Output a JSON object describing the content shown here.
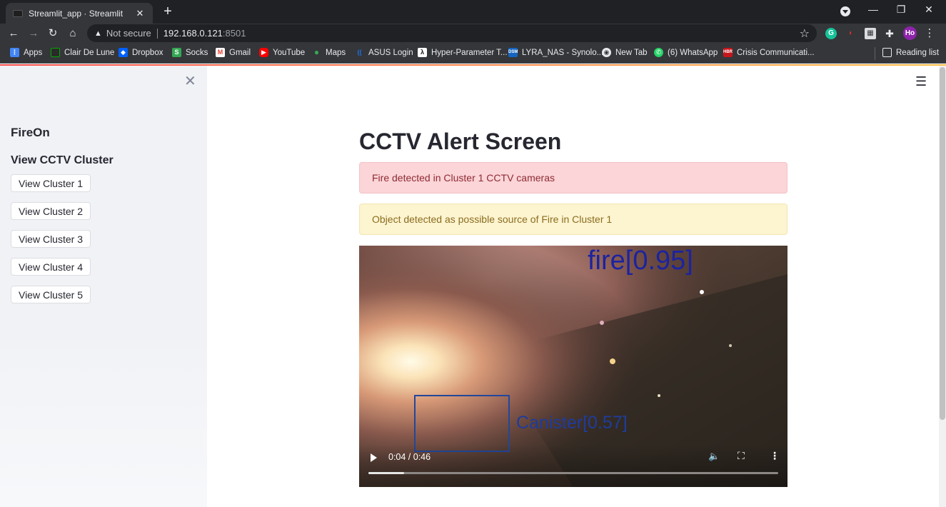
{
  "browser": {
    "tab_title": "Streamlit_app · Streamlit",
    "url_warning": "Not secure",
    "url_host": "192.168.0.121",
    "url_port": ":8501",
    "profile_initials": "Ho"
  },
  "bookmarks": [
    {
      "label": "Apps",
      "icon": "apps-grid-icon",
      "color": "#4285f4"
    },
    {
      "label": "Clair De Lune",
      "icon": "clair-icon",
      "color": "#2a2a2a"
    },
    {
      "label": "Dropbox",
      "icon": "dropbox-icon",
      "color": "#0061fe"
    },
    {
      "label": "Socks",
      "icon": "socks-icon",
      "color": "#34a853"
    },
    {
      "label": "Gmail",
      "icon": "gmail-icon",
      "color": "#ea4335"
    },
    {
      "label": "YouTube",
      "icon": "youtube-icon",
      "color": "#ff0000"
    },
    {
      "label": "Maps",
      "icon": "maps-icon",
      "color": "#34a853"
    },
    {
      "label": "ASUS Login",
      "icon": "asus-icon",
      "color": "#1a73e8"
    },
    {
      "label": "Hyper-Parameter T...",
      "icon": "lambda-icon",
      "color": "#111111"
    },
    {
      "label": "LYRA_NAS - Synolo...",
      "icon": "synology-icon",
      "color": "#1565c0"
    },
    {
      "label": "New Tab",
      "icon": "chrome-icon",
      "color": "#5f6368"
    },
    {
      "label": "(6) WhatsApp",
      "icon": "whatsapp-icon",
      "color": "#25d366"
    },
    {
      "label": "Crisis Communicati...",
      "icon": "hbr-icon",
      "color": "#c4161c"
    }
  ],
  "reading_list": "Reading list",
  "sidebar": {
    "title": "FireOn",
    "subheader": "View CCTV Cluster",
    "buttons": [
      "View Cluster 1",
      "View Cluster 2",
      "View Cluster 3",
      "View Cluster 4",
      "View Cluster 5"
    ]
  },
  "main": {
    "title": "CCTV Alert Screen",
    "error_alert": "Fire detected in Cluster 1 CCTV cameras",
    "warning_alert": "Object detected as possible source of Fire in Cluster 1"
  },
  "video": {
    "detection_fire": "fire[0.95]",
    "detection_canister": "Canister[0.57]",
    "time": "0:04 / 0:46",
    "progress_fraction": 0.087
  },
  "colors": {
    "accent_start": "#ff4b4b",
    "accent_end": "#ffbd45",
    "error_bg": "#fbd5d8",
    "warning_bg": "#fdf4d0"
  }
}
